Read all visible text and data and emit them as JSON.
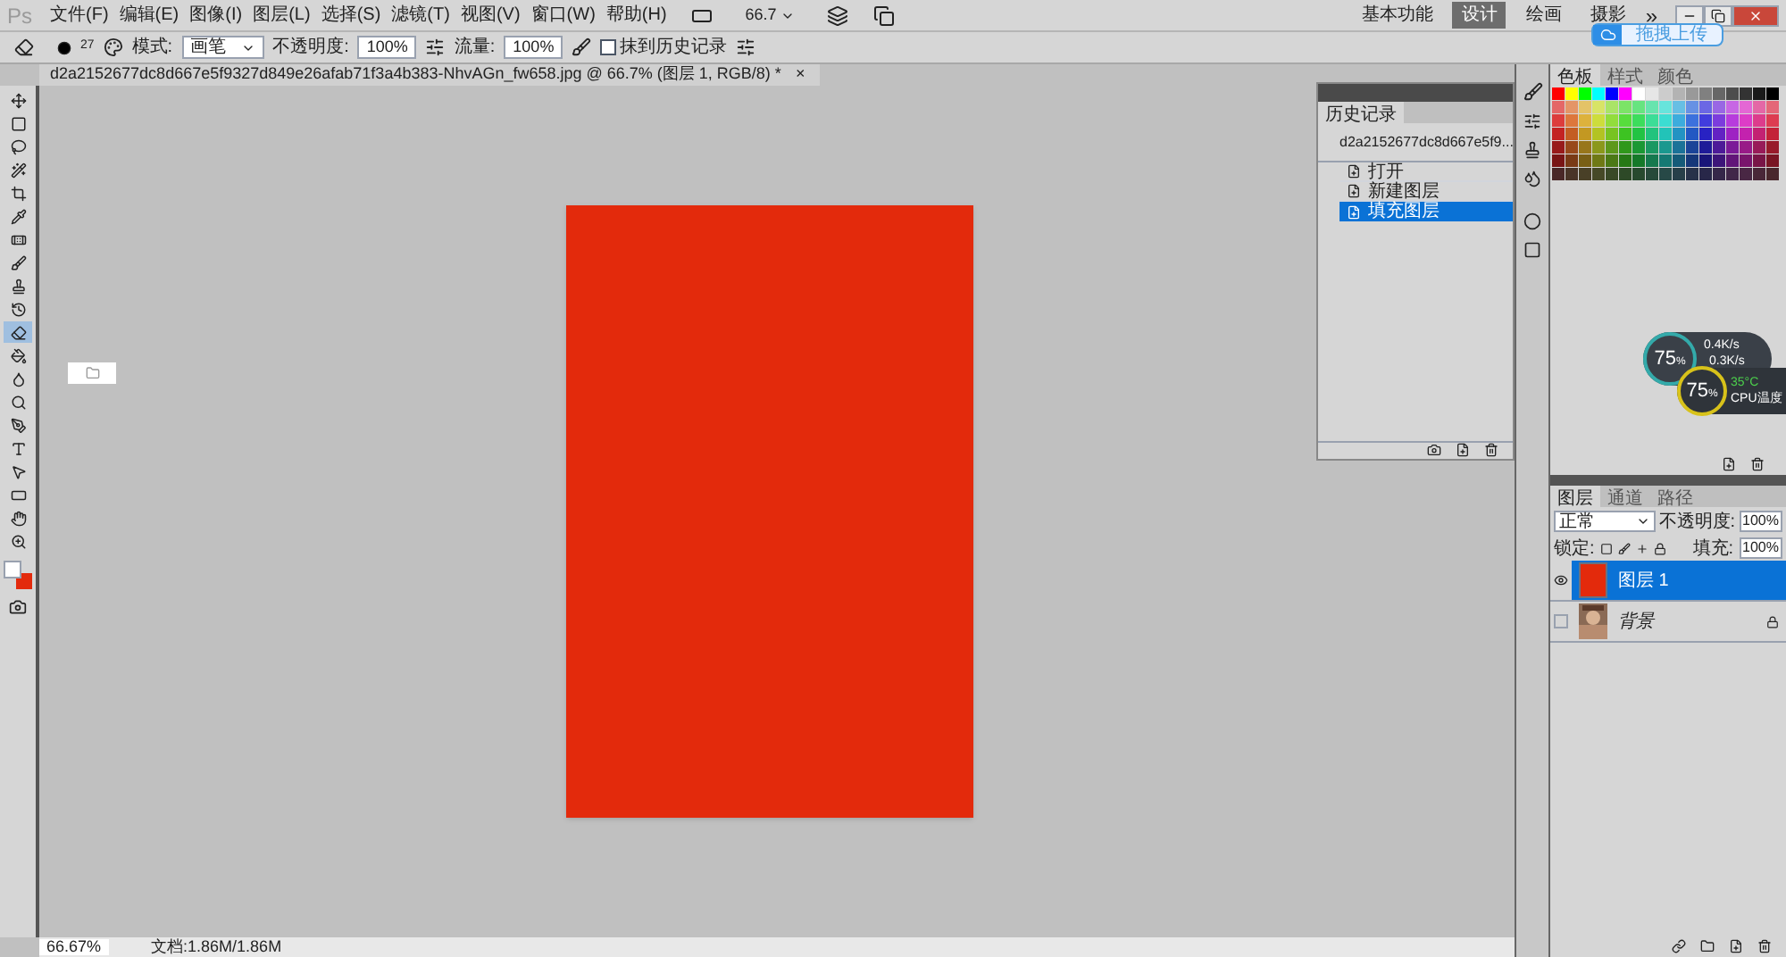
{
  "app": {
    "logo": "Ps",
    "menus": [
      "文件(F)",
      "编辑(E)",
      "图像(I)",
      "图层(L)",
      "选择(S)",
      "滤镜(T)",
      "视图(V)",
      "窗口(W)",
      "帮助(H)"
    ],
    "zoom": "66.7",
    "more": "»",
    "workspaces": [
      {
        "label": "基本功能",
        "selected": false
      },
      {
        "label": "设计",
        "selected": true
      },
      {
        "label": "绘画",
        "selected": false
      },
      {
        "label": "摄影",
        "selected": false
      }
    ]
  },
  "upload_tip": "拖拽上传",
  "options": {
    "brush_size": "27",
    "mode_label": "模式:",
    "mode": "画笔",
    "opacity_label": "不透明度:",
    "opacity": "100%",
    "flow_label": "流量:",
    "flow": "100%",
    "erase_to_history": {
      "label": "抹到历史记录",
      "checked": false
    }
  },
  "tools": [
    {
      "kind": "move",
      "selected": false
    },
    {
      "kind": "marquee",
      "selected": false
    },
    {
      "kind": "lasso",
      "selected": false
    },
    {
      "kind": "wand",
      "selected": false
    },
    {
      "kind": "crop",
      "selected": false
    },
    {
      "kind": "eyedropper",
      "selected": false
    },
    {
      "kind": "heal",
      "selected": false
    },
    {
      "kind": "brush",
      "selected": false
    },
    {
      "kind": "stamp",
      "selected": false
    },
    {
      "kind": "history",
      "selected": false
    },
    {
      "kind": "eraser",
      "selected": true
    },
    {
      "kind": "bucket",
      "selected": false
    },
    {
      "kind": "blur",
      "selected": false
    },
    {
      "kind": "dodge",
      "selected": false
    },
    {
      "kind": "pen",
      "selected": false
    },
    {
      "kind": "type",
      "selected": false
    },
    {
      "kind": "select",
      "selected": false
    },
    {
      "kind": "shape",
      "selected": false
    },
    {
      "kind": "hand",
      "selected": false
    },
    {
      "kind": "zoom",
      "selected": false
    }
  ],
  "document": {
    "tab": "d2a2152677dc8d667e5f9327d849e26afab71f3a4b383-NhvAGn_fw658.jpg @ 66.7% (图层 1, RGB/8) *",
    "close": "×"
  },
  "history": {
    "title": "历史记录",
    "snapshot": "d2a2152677dc8d667e5f9...",
    "items": [
      {
        "label": "打开",
        "selected": false
      },
      {
        "label": "新建图层",
        "selected": false
      },
      {
        "label": "填充图层",
        "selected": true
      }
    ]
  },
  "swatches": {
    "tabs": [
      {
        "label": "色板",
        "selected": true
      },
      {
        "label": "样式",
        "selected": false
      },
      {
        "label": "颜色",
        "selected": false
      }
    ]
  },
  "monitor": {
    "usage": "75",
    "unit": "%",
    "up": "0.4K/s",
    "down": "0.3K/s",
    "cpu": "75",
    "cpu_unit": "%",
    "temp": "35°C",
    "temp_label": "CPU温度"
  },
  "layers_panel": {
    "tabs": [
      {
        "label": "图层",
        "selected": true
      },
      {
        "label": "通道",
        "selected": false
      },
      {
        "label": "路径",
        "selected": false
      }
    ],
    "blend_mode": "正常",
    "opacity_label": "不透明度:",
    "opacity": "100%",
    "lock_label": "锁定:",
    "fill_label": "填充:",
    "fill": "100%",
    "layers": [
      {
        "name": "图层 1",
        "kind": "fill",
        "selected": true,
        "visible": true,
        "locked": false
      },
      {
        "name": "背景",
        "selected": false,
        "visible": false,
        "locked": true
      }
    ]
  },
  "status": {
    "zoom": "66.67%",
    "doc": "文档:1.86M/1.86M"
  }
}
